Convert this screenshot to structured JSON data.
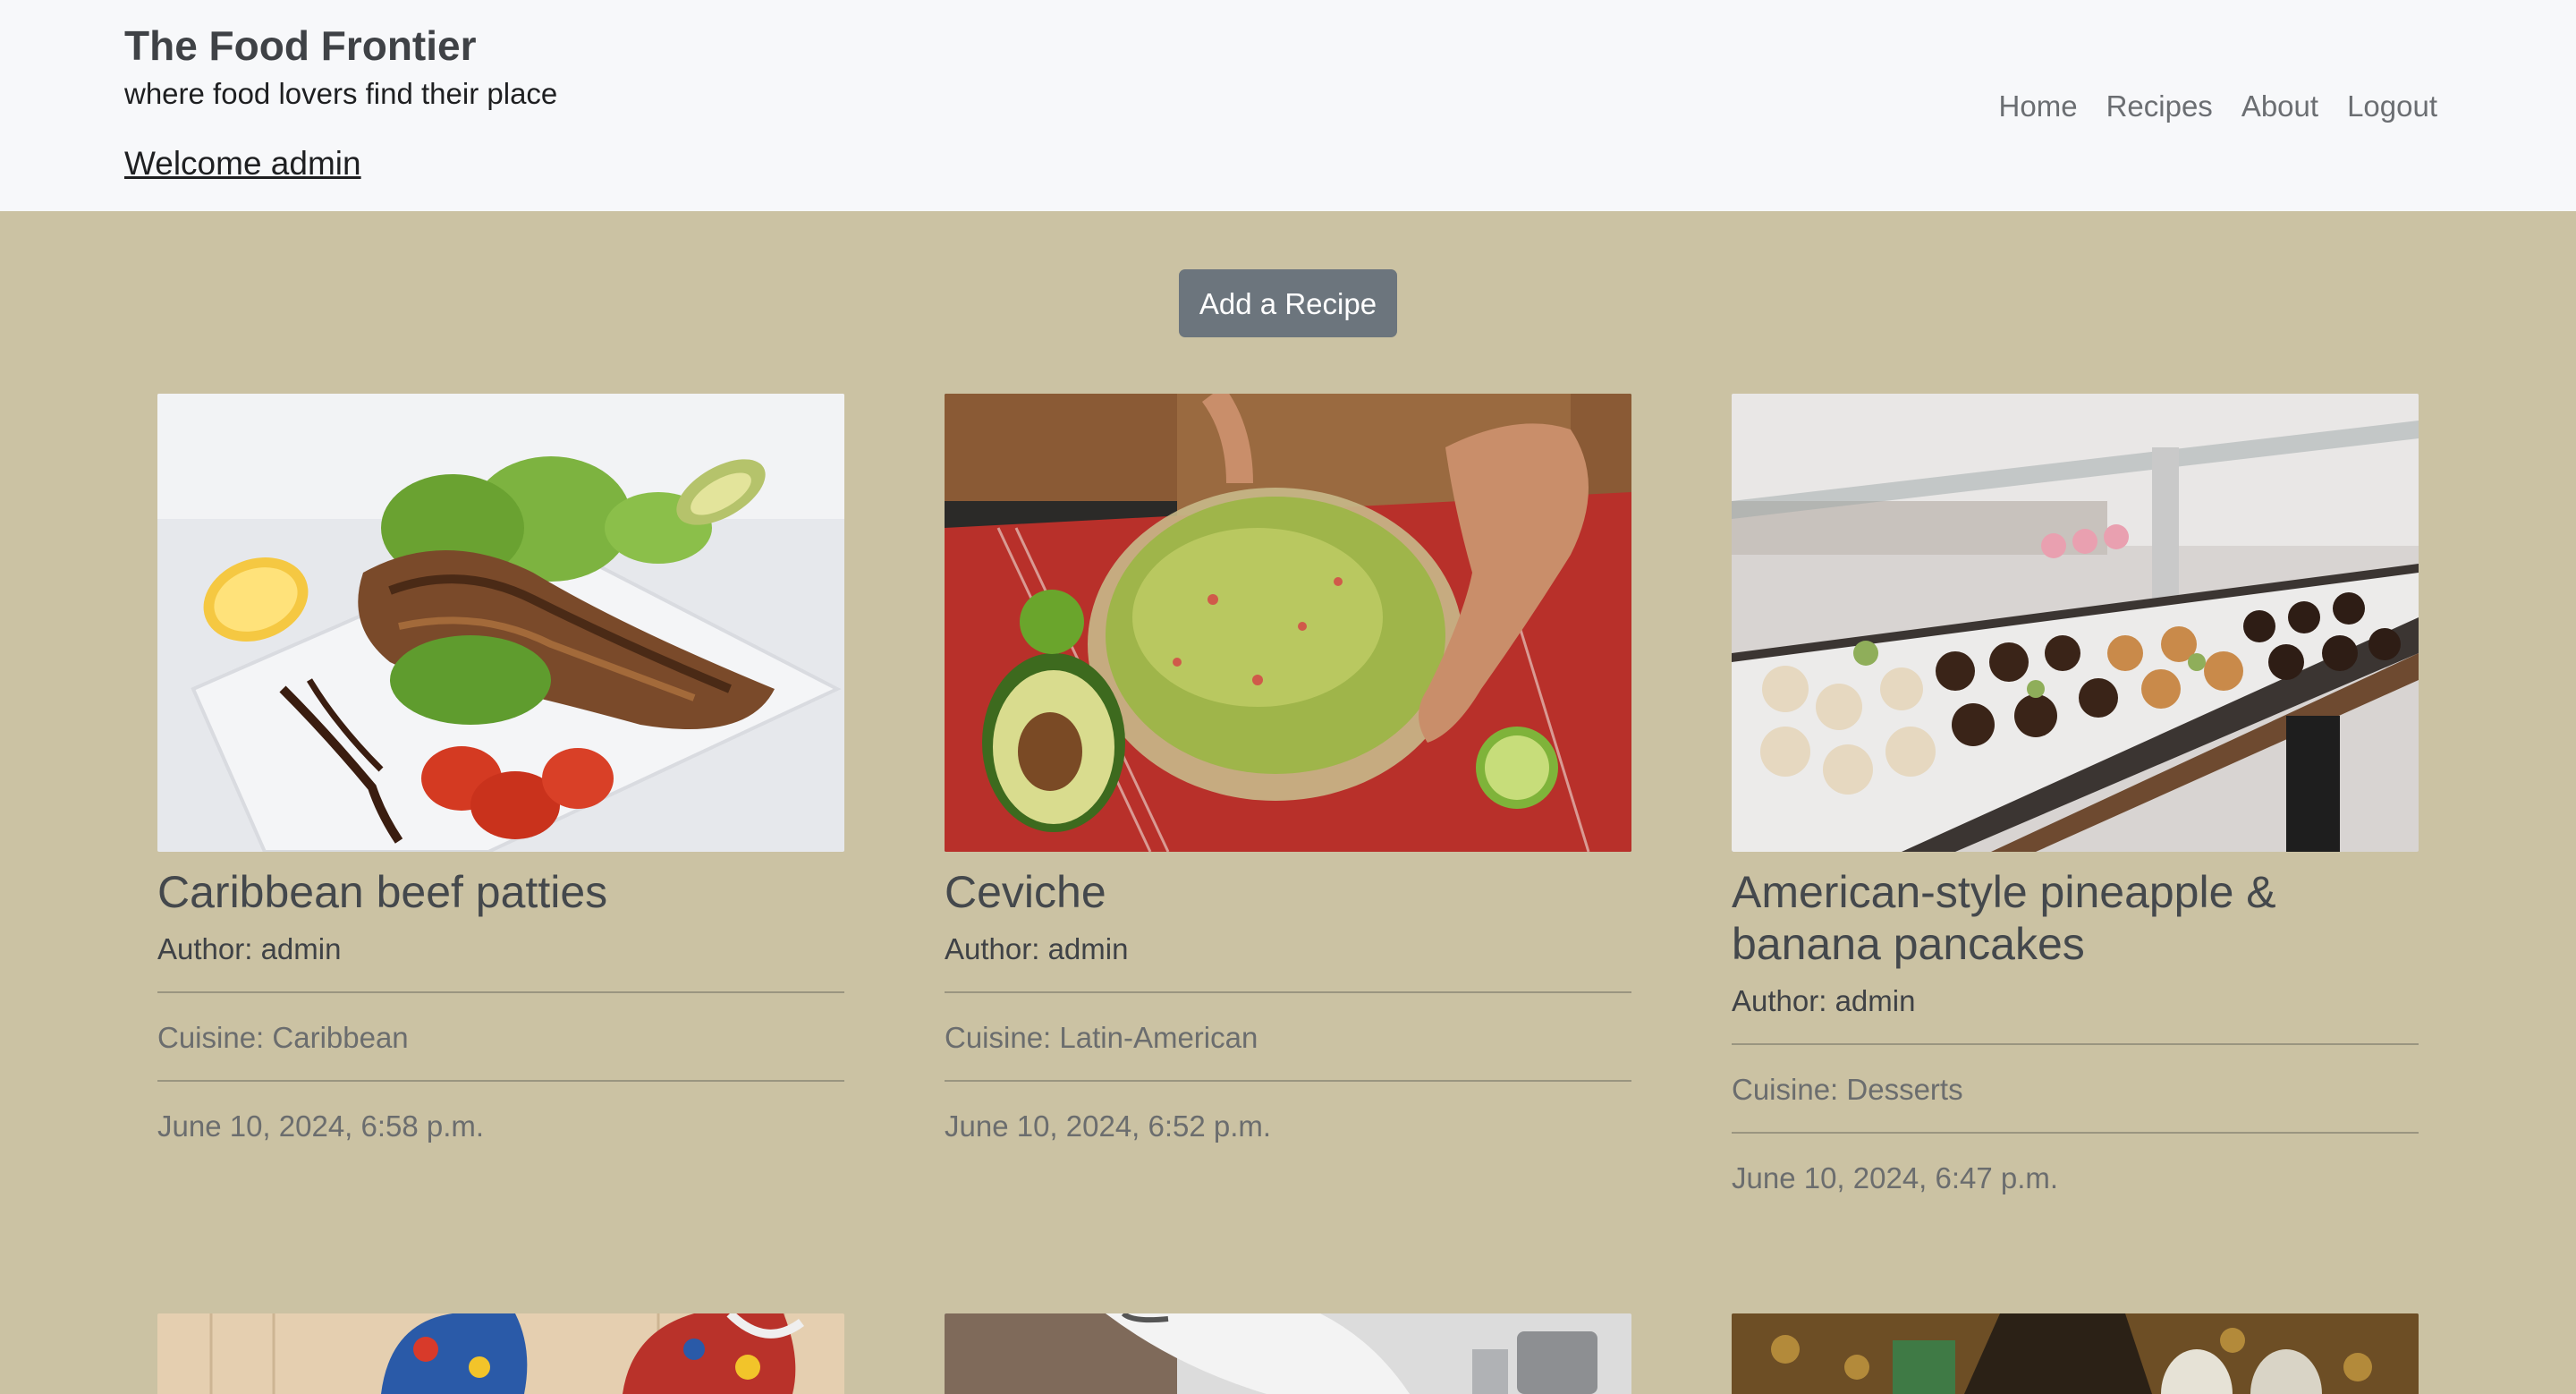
{
  "header": {
    "title": "The Food Frontier",
    "tagline": "where food lovers find their place",
    "welcome": "Welcome admin",
    "nav": [
      "Home",
      "Recipes",
      "About",
      "Logout"
    ]
  },
  "add_button": "Add a Recipe",
  "recipes": [
    {
      "title": "Caribbean beef patties",
      "author": "Author: admin",
      "cuisine": "Cuisine: Caribbean",
      "date": "June 10, 2024, 6:58 p.m."
    },
    {
      "title": "Ceviche",
      "author": "Author: admin",
      "cuisine": "Cuisine: Latin-American",
      "date": "June 10, 2024, 6:52 p.m."
    },
    {
      "title": "American-style pineapple & banana pancakes",
      "author": "Author: admin",
      "cuisine": "Cuisine: Desserts",
      "date": "June 10, 2024, 6:47 p.m."
    }
  ],
  "colors": {
    "page_bg": "#cbc2a3",
    "header_bg": "#f7f8fa",
    "button_bg": "#6c757d"
  }
}
